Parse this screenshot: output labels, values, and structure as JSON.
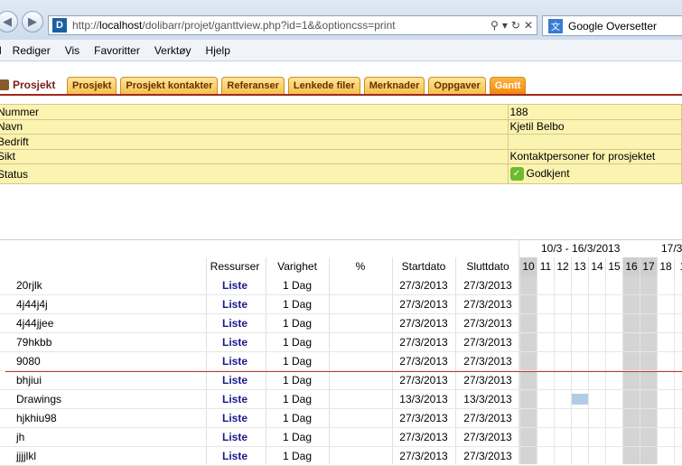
{
  "browser": {
    "url_prefix": "http://",
    "url_host": "localhost",
    "url_path": "/dolibarr/projet/ganttview.php?id=1&&optioncss=print",
    "tab_title": "Google Oversetter",
    "site_icon_letter": "D"
  },
  "menu": [
    "l",
    "Rediger",
    "Vis",
    "Favoritter",
    "Verktøy",
    "Hjelp"
  ],
  "module_title": "Prosjekt",
  "tabs": [
    {
      "label": "Prosjekt",
      "active": false
    },
    {
      "label": "Prosjekt kontakter",
      "active": false
    },
    {
      "label": "Referanser",
      "active": false
    },
    {
      "label": "Lenkede filer",
      "active": false
    },
    {
      "label": "Merknader",
      "active": false
    },
    {
      "label": "Oppgaver",
      "active": false
    },
    {
      "label": "Gantt",
      "active": true
    }
  ],
  "info": {
    "number_label": "Nummer",
    "number_value": "188",
    "name_label": "Navn",
    "name_value": "Kjetil Belbo",
    "company_label": "Bedrift",
    "company_value": "",
    "visibility_label": "Sikt",
    "visibility_value": "Kontaktpersoner for prosjektet",
    "status_label": "Status",
    "status_value": "Godkjent"
  },
  "gantt": {
    "columns": {
      "resources": "Ressurser",
      "duration": "Varighet",
      "percent": "%",
      "start": "Startdato",
      "end": "Sluttdato"
    },
    "week1": "10/3 - 16/3/2013",
    "week2": "17/3",
    "days": [
      "10",
      "11",
      "12",
      "13",
      "14",
      "15",
      "16",
      "17",
      "18",
      "1"
    ],
    "weekend_days": [
      0,
      6,
      7
    ],
    "tasks": [
      {
        "name": "20rjlk",
        "resources": "Liste",
        "duration": "1 Dag",
        "start": "27/3/2013",
        "end": "27/3/2013"
      },
      {
        "name": "4j44j4j",
        "resources": "Liste",
        "duration": "1 Dag",
        "start": "27/3/2013",
        "end": "27/3/2013"
      },
      {
        "name": "4j44jjee",
        "resources": "Liste",
        "duration": "1 Dag",
        "start": "27/3/2013",
        "end": "27/3/2013"
      },
      {
        "name": "79hkbb",
        "resources": "Liste",
        "duration": "1 Dag",
        "start": "27/3/2013",
        "end": "27/3/2013"
      },
      {
        "name": "9080",
        "resources": "Liste",
        "duration": "1 Dag",
        "start": "27/3/2013",
        "end": "27/3/2013"
      },
      {
        "name": "bhjiui",
        "resources": "Liste",
        "duration": "1 Dag",
        "start": "27/3/2013",
        "end": "27/3/2013"
      },
      {
        "name": "Drawings",
        "resources": "Liste",
        "duration": "1 Dag",
        "start": "13/3/2013",
        "end": "13/3/2013"
      },
      {
        "name": "hjkhiu98",
        "resources": "Liste",
        "duration": "1 Dag",
        "start": "27/3/2013",
        "end": "27/3/2013"
      },
      {
        "name": "jh",
        "resources": "Liste",
        "duration": "1 Dag",
        "start": "27/3/2013",
        "end": "27/3/2013"
      },
      {
        "name": "jjjjlkl",
        "resources": "Liste",
        "duration": "1 Dag",
        "start": "27/3/2013",
        "end": "27/3/2013"
      }
    ]
  }
}
